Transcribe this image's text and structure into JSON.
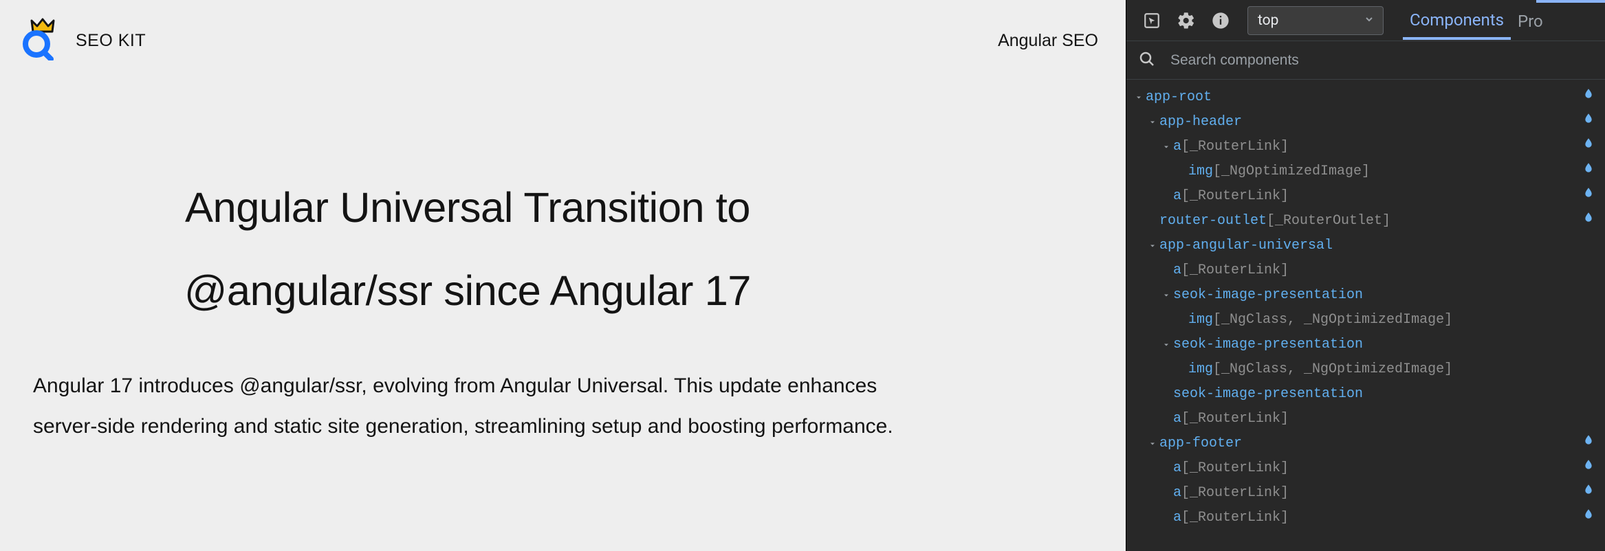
{
  "site": {
    "brand": "SEO KIT",
    "nav_link": "Angular SEO",
    "title_line1": "Angular Universal Transition to",
    "title_line2": "@angular/ssr since Angular 17",
    "paragraph": "Angular 17 introduces @angular/ssr, evolving from Angular Universal. This update enhances server-side rendering and static site generation, streamlining setup and boosting performance."
  },
  "devtools": {
    "frame_selector": "top",
    "tabs": {
      "components": "Components",
      "profiler": "Pro"
    },
    "search_placeholder": "Search components",
    "tree": [
      {
        "indent": 0,
        "caret": "v",
        "name": "app-root",
        "dirs": "",
        "hydrate": true
      },
      {
        "indent": 1,
        "caret": "v",
        "name": "app-header",
        "dirs": "",
        "hydrate": true
      },
      {
        "indent": 2,
        "caret": "v",
        "name": "a",
        "dirs": "[_RouterLink]",
        "hydrate": true
      },
      {
        "indent": 3,
        "caret": "",
        "name": "img",
        "dirs": "[_NgOptimizedImage]",
        "hydrate": true
      },
      {
        "indent": 2,
        "caret": "",
        "name": "a",
        "dirs": "[_RouterLink]",
        "hydrate": true
      },
      {
        "indent": 1,
        "caret": "",
        "name": "router-outlet",
        "dirs": "[_RouterOutlet]",
        "hydrate": true
      },
      {
        "indent": 1,
        "caret": "v",
        "name": "app-angular-universal",
        "dirs": "",
        "hydrate": false
      },
      {
        "indent": 2,
        "caret": "",
        "name": "a",
        "dirs": "[_RouterLink]",
        "hydrate": false
      },
      {
        "indent": 2,
        "caret": "v",
        "name": "seok-image-presentation",
        "dirs": "",
        "hydrate": false
      },
      {
        "indent": 3,
        "caret": "",
        "name": "img",
        "dirs": "[_NgClass, _NgOptimizedImage]",
        "hydrate": false
      },
      {
        "indent": 2,
        "caret": "v",
        "name": "seok-image-presentation",
        "dirs": "",
        "hydrate": false
      },
      {
        "indent": 3,
        "caret": "",
        "name": "img",
        "dirs": "[_NgClass, _NgOptimizedImage]",
        "hydrate": false
      },
      {
        "indent": 2,
        "caret": "",
        "name": "seok-image-presentation",
        "dirs": "",
        "hydrate": false
      },
      {
        "indent": 2,
        "caret": "",
        "name": "a",
        "dirs": "[_RouterLink]",
        "hydrate": false
      },
      {
        "indent": 1,
        "caret": "v",
        "name": "app-footer",
        "dirs": "",
        "hydrate": true
      },
      {
        "indent": 2,
        "caret": "",
        "name": "a",
        "dirs": "[_RouterLink]",
        "hydrate": true
      },
      {
        "indent": 2,
        "caret": "",
        "name": "a",
        "dirs": "[_RouterLink]",
        "hydrate": true
      },
      {
        "indent": 2,
        "caret": "",
        "name": "a",
        "dirs": "[_RouterLink]",
        "hydrate": true
      }
    ]
  }
}
